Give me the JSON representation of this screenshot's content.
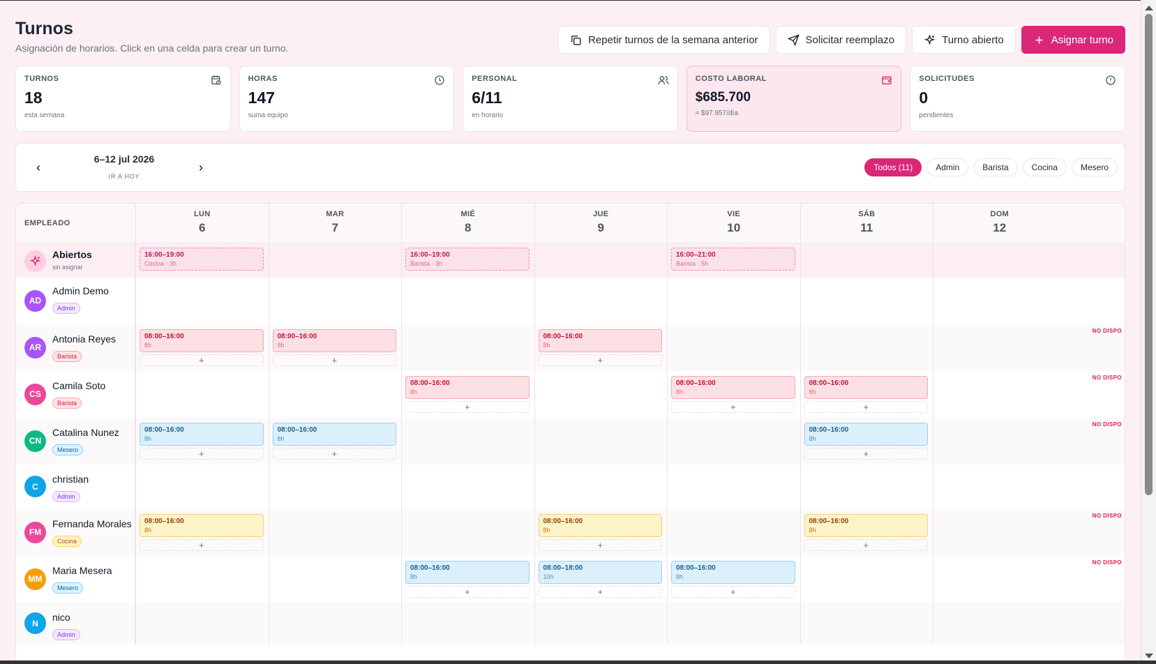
{
  "header": {
    "title": "Turnos",
    "subtitle": "Asignación de horarios. Click en una celda para crear un turno.",
    "actions": {
      "repeat": "Repetir turnos de la semana anterior",
      "replace": "Solicitar reemplazo",
      "open": "Turno abierto",
      "assign": "Asignar turno"
    }
  },
  "stats": [
    {
      "label": "TURNOS",
      "value": "18",
      "hint": "esta semana",
      "icon": "calendar-clock-icon"
    },
    {
      "label": "HORAS",
      "value": "147",
      "hint": "suma equipo",
      "icon": "clock-icon"
    },
    {
      "label": "PERSONAL",
      "value": "6/11",
      "hint": "en horario",
      "icon": "users-icon"
    },
    {
      "label": "COSTO LABORAL",
      "value": "$685.700",
      "hint": "≈ $97.957/día",
      "icon": "wallet-icon"
    },
    {
      "label": "SOLICITUDES",
      "value": "0",
      "hint": "pendientes",
      "icon": "alert-circle-icon"
    }
  ],
  "week": {
    "range": "6–12 jul 2026",
    "today": "IR A HOY",
    "filters": [
      "Todos (11)",
      "Admin",
      "Barista",
      "Cocina",
      "Mesero"
    ],
    "active_filter": "Todos (11)"
  },
  "grid": {
    "employee_header": "EMPLEADO",
    "days": [
      {
        "name": "LUN",
        "num": "6"
      },
      {
        "name": "MAR",
        "num": "7"
      },
      {
        "name": "MIÉ",
        "num": "8"
      },
      {
        "name": "JUE",
        "num": "9"
      },
      {
        "name": "VIE",
        "num": "10"
      },
      {
        "name": "SÁB",
        "num": "11"
      },
      {
        "name": "DOM",
        "num": "12"
      }
    ],
    "plus": "+",
    "no_dispo": "NO DISPO",
    "open_row": {
      "name": "Abiertos",
      "sub": "sin asignar"
    },
    "employees": [
      {
        "initials": "AD",
        "name": "Admin Demo",
        "role": "Admin",
        "color": "#a855f7"
      },
      {
        "initials": "AR",
        "name": "Antonia Reyes",
        "role": "Barista",
        "color": "#a855f7"
      },
      {
        "initials": "CS",
        "name": "Camila Soto",
        "role": "Barista",
        "color": "#ec4899"
      },
      {
        "initials": "CN",
        "name": "Catalina Nunez",
        "role": "Mesero",
        "color": "#10b981"
      },
      {
        "initials": "C",
        "name": "christian",
        "role": "Admin",
        "color": "#0ea5e9"
      },
      {
        "initials": "FM",
        "name": "Fernanda Morales",
        "role": "Cocina",
        "color": "#ec4899"
      },
      {
        "initials": "MM",
        "name": "Maria Mesera",
        "role": "Mesero",
        "color": "#f59e0b"
      },
      {
        "initials": "N",
        "name": "nico",
        "role": "Admin",
        "color": "#0ea5e9"
      }
    ],
    "shifts": {
      "open": [
        {
          "day": 0,
          "time": "16:00–19:00",
          "detail": "Cocina · 3h"
        },
        {
          "day": 2,
          "time": "16:00–19:00",
          "detail": "Barista · 3h"
        },
        {
          "day": 4,
          "time": "16:00–21:00",
          "detail": "Barista · 5h"
        }
      ],
      "emp1": [
        {
          "day": 0,
          "time": "08:00–16:00",
          "detail": "8h"
        },
        {
          "day": 1,
          "time": "08:00–16:00",
          "detail": "8h"
        },
        {
          "day": 3,
          "time": "08:00–16:00",
          "detail": "8h"
        }
      ],
      "emp2": [
        {
          "day": 2,
          "time": "08:00–16:00",
          "detail": "8h"
        },
        {
          "day": 4,
          "time": "08:00–16:00",
          "detail": "8h"
        },
        {
          "day": 5,
          "time": "08:00–16:00",
          "detail": "8h"
        }
      ],
      "emp3": [
        {
          "day": 0,
          "time": "08:00–16:00",
          "detail": "8h"
        },
        {
          "day": 1,
          "time": "08:00–16:00",
          "detail": "8h"
        },
        {
          "day": 5,
          "time": "08:00–16:00",
          "detail": "8h"
        }
      ],
      "emp5": [
        {
          "day": 0,
          "time": "08:00–16:00",
          "detail": "8h"
        },
        {
          "day": 3,
          "time": "08:00–16:00",
          "detail": "8h"
        },
        {
          "day": 5,
          "time": "08:00–16:00",
          "detail": "8h"
        }
      ],
      "emp6": [
        {
          "day": 2,
          "time": "08:00–16:00",
          "detail": "8h"
        },
        {
          "day": 3,
          "time": "08:00–18:00",
          "detail": "10h"
        },
        {
          "day": 4,
          "time": "08:00–16:00",
          "detail": "8h"
        }
      ]
    }
  },
  "colors": {
    "accent": "#db2777",
    "admin_badge": "#7c3aed",
    "barista_badge": "#e11d48",
    "mesero_badge": "#0369a1",
    "cocina_badge": "#b45309"
  }
}
